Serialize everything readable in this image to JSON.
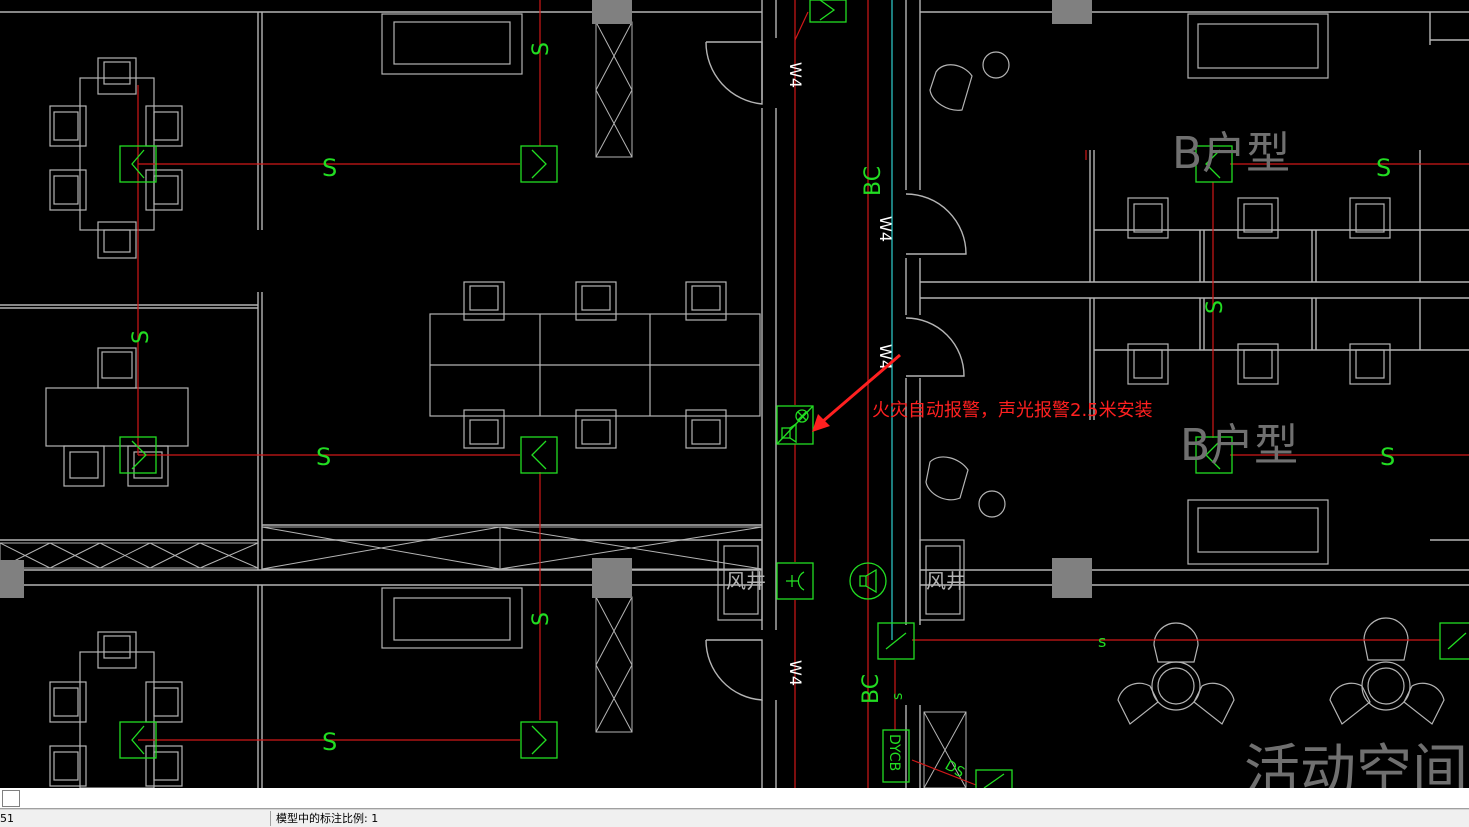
{
  "drawing": {
    "annotation_text": "火灾自动报警，声光报警2.5米安装",
    "circuit_labels": {
      "s": "S",
      "s_lower": "s",
      "w4": "W4",
      "bc": "BC",
      "dycb": "DYCB",
      "ds": "DS"
    },
    "room_labels": {
      "unit_b_1": "B户型",
      "unit_b_2": "B户型",
      "activity_space": "活动空间"
    },
    "shaft_labels": {
      "left": "风井",
      "right": "风井"
    },
    "colors": {
      "background": "#000000",
      "walls": "#b4b4b4",
      "circuit": "#d01818",
      "devices": "#22dd22",
      "annotation": "#ff2020",
      "column": "#808080",
      "room_text": "#707070",
      "cyan_line": "#30d0d0"
    }
  },
  "statusbar": {
    "coordinate": "51",
    "annotation_scale": "模型中的标注比例: 1"
  }
}
